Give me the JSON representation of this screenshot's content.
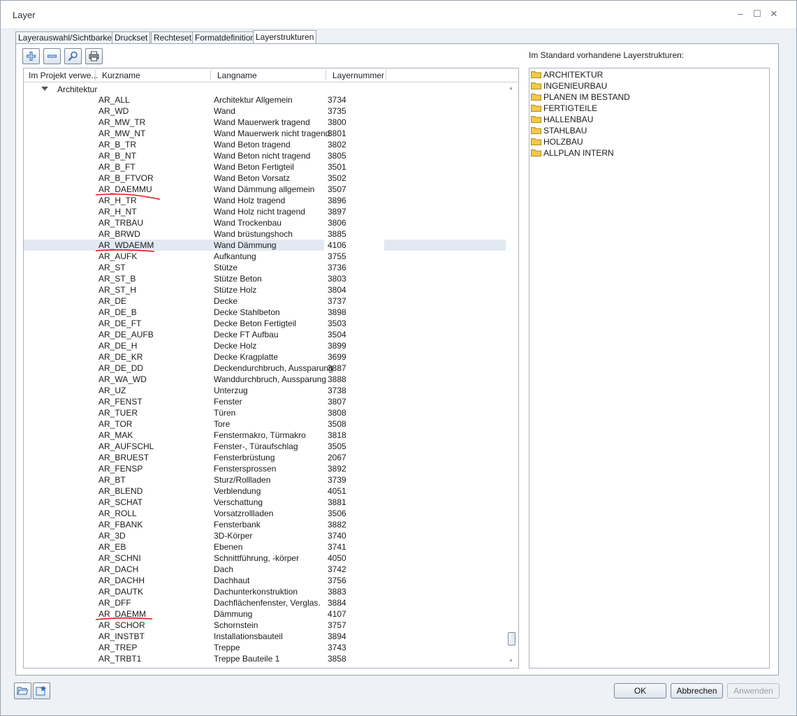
{
  "window": {
    "title": "Layer",
    "minimize": "–",
    "maximize": "☐",
    "close": "✕"
  },
  "tabs": [
    {
      "label": "Layerauswahl/Sichtbarkeit"
    },
    {
      "label": "Druckset"
    },
    {
      "label": "Rechteset"
    },
    {
      "label": "Formatdefinition"
    },
    {
      "label": "Layerstrukturen",
      "active": true
    }
  ],
  "toolbar": [
    {
      "icon": "add-icon"
    },
    {
      "icon": "remove-icon"
    },
    {
      "icon": "search-icon"
    },
    {
      "icon": "print-icon"
    }
  ],
  "tree": {
    "columns": [
      "Im Projekt verwe...",
      "Kurzname",
      "Langname",
      "Layernummer"
    ],
    "group": "Architektur",
    "selected_row": 13,
    "rows": [
      [
        "AR_ALL",
        "Architektur Allgemein",
        "3734"
      ],
      [
        "AR_WD",
        "Wand",
        "3735"
      ],
      [
        "AR_MW_TR",
        "Wand Mauerwerk tragend",
        "3800"
      ],
      [
        "AR_MW_NT",
        "Wand Mauerwerk nicht tragend",
        "3801"
      ],
      [
        "AR_B_TR",
        "Wand Beton tragend",
        "3802"
      ],
      [
        "AR_B_NT",
        "Wand Beton nicht tragend",
        "3805"
      ],
      [
        "AR_B_FT",
        "Wand Beton Fertigteil",
        "3501"
      ],
      [
        "AR_B_FTVOR",
        "Wand Beton Vorsatz",
        "3502"
      ],
      [
        "AR_DAEMMU",
        "Wand Dämmung allgemein",
        "3507"
      ],
      [
        "AR_H_TR",
        "Wand Holz tragend",
        "3896"
      ],
      [
        "AR_H_NT",
        "Wand Holz nicht tragend",
        "3897"
      ],
      [
        "AR_TRBAU",
        "Wand Trockenbau",
        "3806"
      ],
      [
        "AR_BRWD",
        "Wand brüstungshoch",
        "3885"
      ],
      [
        "AR_WDAEMM",
        "Wand Dämmung",
        "4106"
      ],
      [
        "AR_AUFK",
        "Aufkantung",
        "3755"
      ],
      [
        "AR_ST",
        "Stütze",
        "3736"
      ],
      [
        "AR_ST_B",
        "Stütze Beton",
        "3803"
      ],
      [
        "AR_ST_H",
        "Stütze Holz",
        "3804"
      ],
      [
        "AR_DE",
        "Decke",
        "3737"
      ],
      [
        "AR_DE_B",
        "Decke Stahlbeton",
        "3898"
      ],
      [
        "AR_DE_FT",
        "Decke Beton Fertigteil",
        "3503"
      ],
      [
        "AR_DE_AUFB",
        "Decke FT Aufbau",
        "3504"
      ],
      [
        "AR_DE_H",
        "Decke Holz",
        "3899"
      ],
      [
        "AR_DE_KR",
        "Decke Kragplatte",
        "3699"
      ],
      [
        "AR_DE_DD",
        "Deckendurchbruch, Aussparung",
        "3887"
      ],
      [
        "AR_WA_WD",
        "Wanddurchbruch, Aussparung",
        "3888"
      ],
      [
        "AR_UZ",
        "Unterzug",
        "3738"
      ],
      [
        "AR_FENST",
        "Fenster",
        "3807"
      ],
      [
        "AR_TUER",
        "Türen",
        "3808"
      ],
      [
        "AR_TOR",
        "Tore",
        "3508"
      ],
      [
        "AR_MAK",
        "Fenstermakro, Türmakro",
        "3818"
      ],
      [
        "AR_AUFSCHL",
        "Fenster-, Türaufschlag",
        "3505"
      ],
      [
        "AR_BRUEST",
        "Fensterbrüstung",
        "2067"
      ],
      [
        "AR_FENSP",
        "Fenstersprossen",
        "3892"
      ],
      [
        "AR_BT",
        "Sturz/Rollladen",
        "3739"
      ],
      [
        "AR_BLEND",
        "Verblendung",
        "4051"
      ],
      [
        "AR_SCHAT",
        "Verschattung",
        "3881"
      ],
      [
        "AR_ROLL",
        "Vorsatzrollladen",
        "3506"
      ],
      [
        "AR_FBANK",
        "Fensterbank",
        "3882"
      ],
      [
        "AR_3D",
        "3D-Körper",
        "3740"
      ],
      [
        "AR_EB",
        "Ebenen",
        "3741"
      ],
      [
        "AR_SCHNI",
        "Schnittführung, -körper",
        "4050"
      ],
      [
        "AR_DACH",
        "Dach",
        "3742"
      ],
      [
        "AR_DACHH",
        "Dachhaut",
        "3756"
      ],
      [
        "AR_DAUTK",
        "Dachunterkonstruktion",
        "3883"
      ],
      [
        "AR_DFF",
        "Dachflächenfenster, Verglas.",
        "3884"
      ],
      [
        "AR_DAEMM",
        "Dämmung",
        "4107"
      ],
      [
        "AR_SCHOR",
        "Schornstein",
        "3757"
      ],
      [
        "AR_INSTBT",
        "Installationsbauteil",
        "3894"
      ],
      [
        "AR_TREP",
        "Treppe",
        "3743"
      ],
      [
        "AR_TRBT1",
        "Treppe Bauteile 1",
        "3858"
      ]
    ],
    "annotation_color": "#e01818"
  },
  "right_panel": {
    "label": "Im Standard vorhandene Layerstrukturen:",
    "items": [
      "ARCHITEKTUR",
      "INGENIEURBAU",
      "PLANEN IM BESTAND",
      "FERTIGTEILE",
      "HALLENBAU",
      "STAHLBAU",
      "HOLZBAU",
      "ALLPLAN INTERN"
    ],
    "folder_color": "#f1c94a"
  },
  "footer": {
    "icons": [
      "open-folder-icon",
      "favorites-icon"
    ],
    "ok": "OK",
    "cancel": "Abbrechen",
    "apply": "Anwenden"
  }
}
